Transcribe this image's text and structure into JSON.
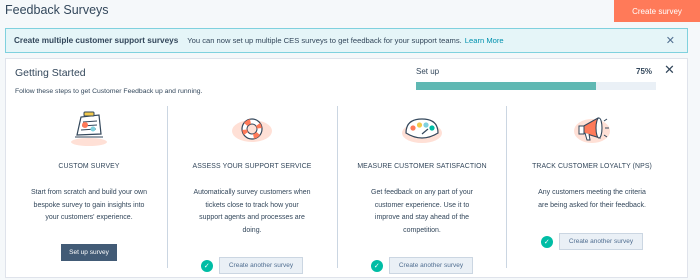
{
  "header": {
    "title": "Feedback Surveys",
    "create_label": "Create survey"
  },
  "banner": {
    "title": "Create multiple customer support surveys",
    "message": "You can now set up multiple CES surveys to get feedback for your support teams.",
    "link": "Learn More",
    "close_icon": "close-icon"
  },
  "getting_started": {
    "title": "Getting Started",
    "subtitle": "Follow these steps to get Customer Feedback up and running.",
    "setup_label": "Set up",
    "progress_text": "75%",
    "progress_value": 0.75
  },
  "steps": [
    {
      "title": "CUSTOM SURVEY",
      "description": "Start from scratch and build your own bespoke survey to gain insights into your customers' experience.",
      "button": "Set up survey",
      "completed": false,
      "icon": "survey-clipboard-icon"
    },
    {
      "title": "ASSESS YOUR SUPPORT SERVICE",
      "description": "Automatically survey customers when tickets close to track how your support agents and processes are doing.",
      "button": "Create another survey",
      "completed": true,
      "icon": "life-ring-icon"
    },
    {
      "title": "MEASURE CUSTOMER SATISFACTION",
      "description": "Get feedback on any part of your customer experience. Use it to improve and stay ahead of the competition.",
      "button": "Create another survey",
      "completed": true,
      "icon": "satisfaction-gauge-icon"
    },
    {
      "title": "TRACK CUSTOMER LOYALTY (NPS)",
      "description": "Any customers meeting the criteria are being asked for their feedback.",
      "button": "Create another survey",
      "completed": true,
      "icon": "megaphone-icon"
    }
  ],
  "colors": {
    "accent": "#ff7a59",
    "progress": "#5fb8b3",
    "check": "#00bda5",
    "primary_button": "#425b76"
  }
}
